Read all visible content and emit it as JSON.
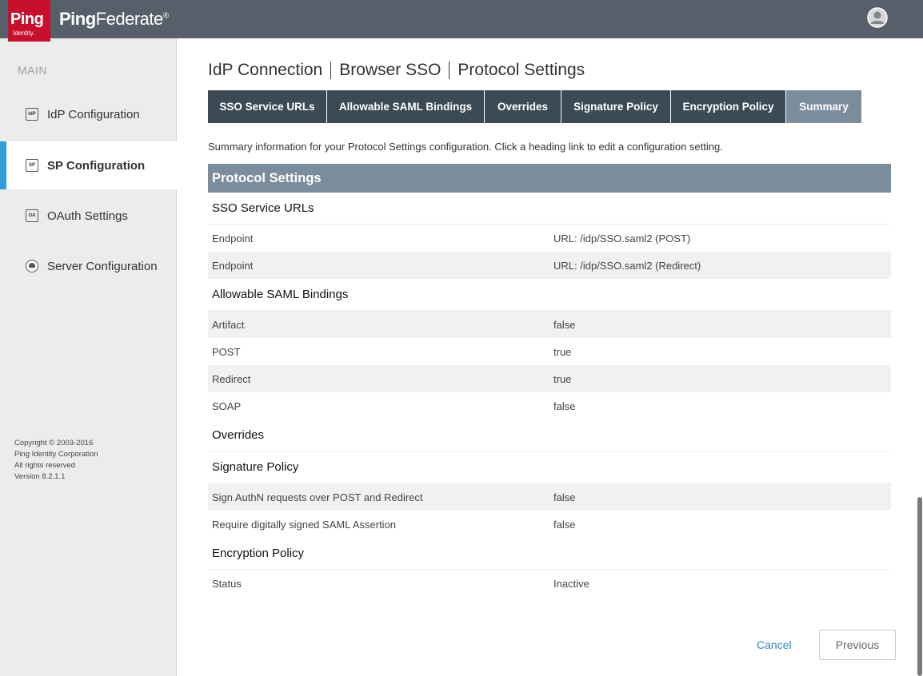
{
  "header": {
    "logo_text": "Ping",
    "logo_subtext": "Identity.",
    "product_name_bold": "Ping",
    "product_name_rest": "Federate",
    "product_mark": "®"
  },
  "sidebar": {
    "heading": "MAIN",
    "items": [
      {
        "label": "IdP Configuration",
        "icon": "IdP",
        "active": false
      },
      {
        "label": "SP Configuration",
        "icon": "SP",
        "active": true
      },
      {
        "label": "OAuth Settings",
        "icon": "OA",
        "active": false
      },
      {
        "label": "Server Configuration",
        "icon": "server-icon",
        "active": false
      }
    ],
    "copyright": [
      "Copyright © 2003-2016",
      "Ping Identity Corporation",
      "All rights reserved",
      "Version 8.2.1.1"
    ]
  },
  "breadcrumb": [
    "IdP Connection",
    "Browser SSO",
    "Protocol Settings"
  ],
  "tabs": [
    {
      "label": "SSO Service URLs"
    },
    {
      "label": "Allowable SAML Bindings"
    },
    {
      "label": "Overrides"
    },
    {
      "label": "Signature Policy"
    },
    {
      "label": "Encryption Policy"
    },
    {
      "label": "Summary",
      "active": true
    }
  ],
  "summary_text": "Summary information for your Protocol Settings configuration. Click a heading link to edit a configuration setting.",
  "section_title": "Protocol Settings",
  "groups": [
    {
      "title": "SSO Service URLs",
      "rows": [
        {
          "key": "Endpoint",
          "value": "URL: /idp/SSO.saml2 (POST)"
        },
        {
          "key": "Endpoint",
          "value": "URL: /idp/SSO.saml2 (Redirect)"
        }
      ]
    },
    {
      "title": "Allowable SAML Bindings",
      "rows": [
        {
          "key": "Artifact",
          "value": "false"
        },
        {
          "key": "POST",
          "value": "true"
        },
        {
          "key": "Redirect",
          "value": "true"
        },
        {
          "key": "SOAP",
          "value": "false"
        }
      ]
    },
    {
      "title": "Overrides",
      "rows": []
    },
    {
      "title": "Signature Policy",
      "rows": [
        {
          "key": "Sign AuthN requests over POST and Redirect",
          "value": "false"
        },
        {
          "key": "Require digitally signed SAML Assertion",
          "value": "false"
        }
      ]
    },
    {
      "title": "Encryption Policy",
      "rows": [
        {
          "key": "Status",
          "value": "Inactive"
        }
      ]
    }
  ],
  "footer": {
    "cancel_label": "Cancel",
    "previous_label": "Previous"
  },
  "colors": {
    "topbar": "#57606a",
    "brand_red": "#c8102e",
    "tab_dark": "#3c4a56",
    "tab_active": "#7b8c9c",
    "accent_blue": "#2f9ed8",
    "link_blue": "#2f86c8"
  }
}
